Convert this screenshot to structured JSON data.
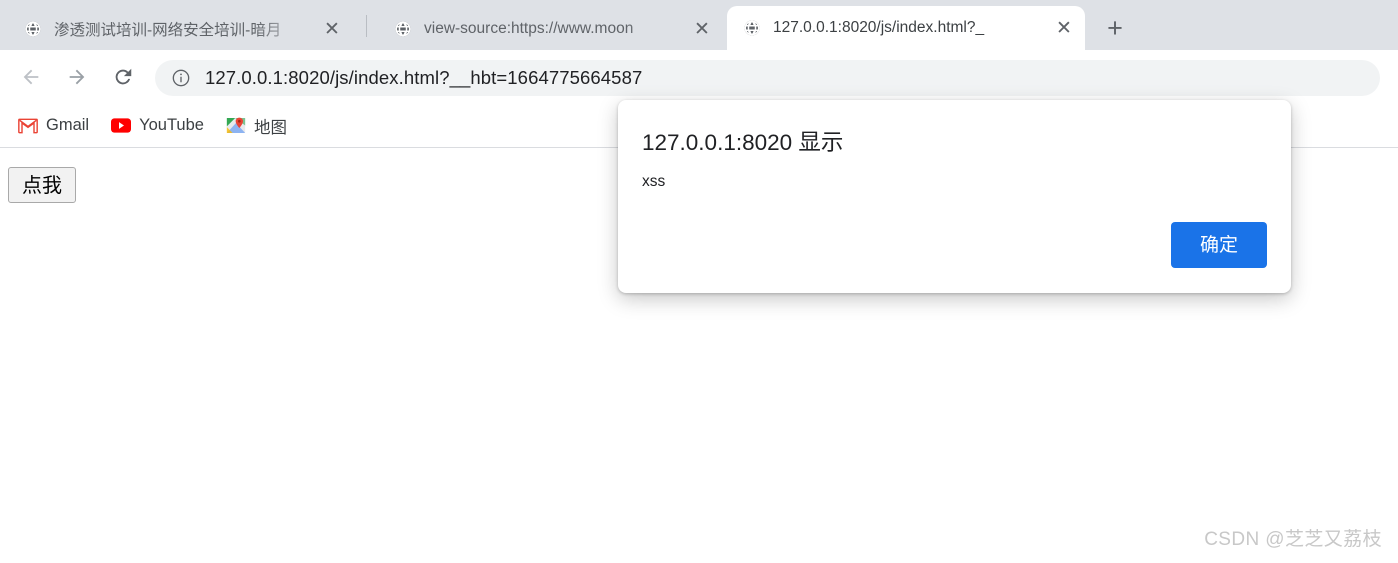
{
  "browser": {
    "tabs": [
      {
        "title": "渗透测试培训-网络安全培训-暗月",
        "favicon": "globe-icon",
        "active": false,
        "close_label": "✕"
      },
      {
        "title": "view-source:https://www.moon",
        "favicon": "globe-icon",
        "active": false,
        "close_label": "✕"
      },
      {
        "title": "127.0.0.1:8020/js/index.html?_",
        "favicon": "globe-icon",
        "active": true,
        "close_label": "✕"
      }
    ],
    "new_tab_label": "+",
    "toolbar": {
      "back_icon": "back-arrow-icon",
      "forward_icon": "forward-arrow-icon",
      "reload_icon": "reload-icon",
      "security_icon": "info-circle-icon",
      "url": "127.0.0.1:8020/js/index.html?__hbt=1664775664587"
    },
    "bookmarks": [
      {
        "label": "Gmail",
        "icon": "gmail-icon"
      },
      {
        "label": "YouTube",
        "icon": "youtube-icon"
      },
      {
        "label": "地图",
        "icon": "google-maps-icon"
      }
    ]
  },
  "page": {
    "button_label": "点我",
    "watermark": "CSDN @芝芝又荔枝"
  },
  "dialog": {
    "title": "127.0.0.1:8020 显示",
    "message": "xss",
    "ok_label": "确定"
  },
  "colors": {
    "tabstrip_bg": "#dee1e6",
    "accent_blue": "#1a73e8",
    "omnibox_bg": "#f1f3f4",
    "text_primary": "#202124",
    "text_secondary": "#5f6368",
    "watermark": "#c8c8c8"
  }
}
